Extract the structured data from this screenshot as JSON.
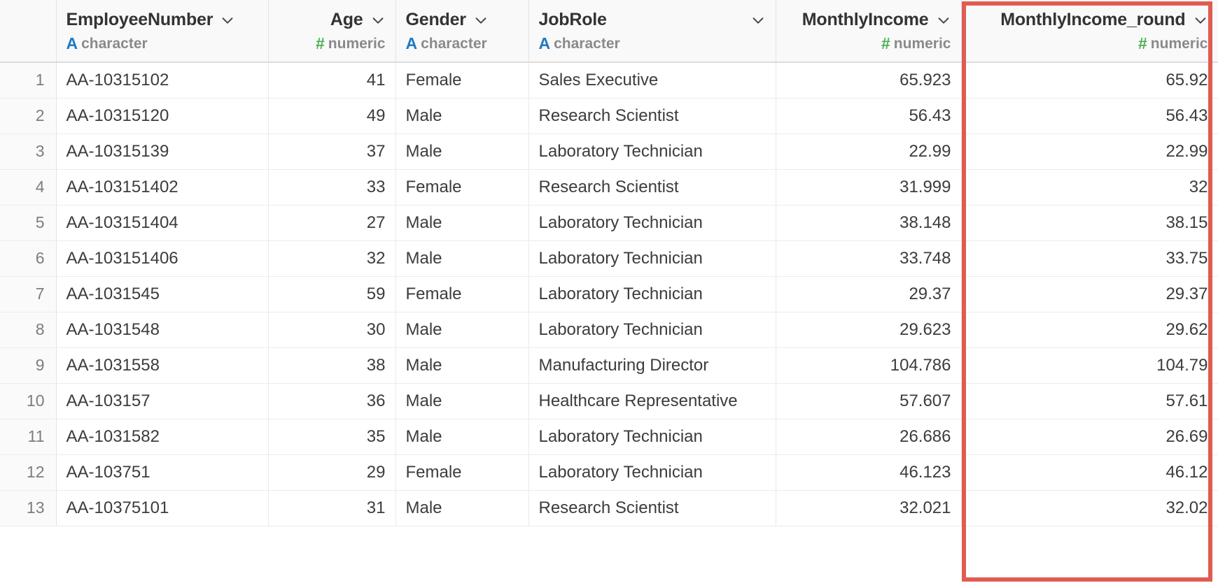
{
  "table": {
    "row_number_header": "",
    "columns": [
      {
        "name": "EmployeeNumber",
        "type_glyph": "A",
        "type_label": "character",
        "type_class": "character",
        "align": "left",
        "header_align": "align-left",
        "cell_align": "txt"
      },
      {
        "name": "Age",
        "type_glyph": "#",
        "type_label": "numeric",
        "type_class": "numeric",
        "align": "right",
        "header_align": "align-right",
        "cell_align": "num"
      },
      {
        "name": "Gender",
        "type_glyph": "A",
        "type_label": "character",
        "type_class": "character",
        "align": "left",
        "header_align": "align-left",
        "cell_align": "txt"
      },
      {
        "name": "JobRole",
        "type_glyph": "A",
        "type_label": "character",
        "type_class": "character",
        "align": "left",
        "header_align": "align-spread",
        "cell_align": "txt"
      },
      {
        "name": "MonthlyIncome",
        "type_glyph": "#",
        "type_label": "numeric",
        "type_class": "numeric",
        "align": "right",
        "header_align": "align-right",
        "cell_align": "num"
      },
      {
        "name": "MonthlyIncome_round",
        "type_glyph": "#",
        "type_label": "numeric",
        "type_class": "numeric",
        "align": "right",
        "header_align": "align-right",
        "cell_align": "num"
      }
    ],
    "rows": [
      {
        "n": "1",
        "EmployeeNumber": "AA-10315102",
        "Age": "41",
        "Gender": "Female",
        "JobRole": "Sales Executive",
        "MonthlyIncome": "65.923",
        "MonthlyIncome_round": "65.92"
      },
      {
        "n": "2",
        "EmployeeNumber": "AA-10315120",
        "Age": "49",
        "Gender": "Male",
        "JobRole": "Research Scientist",
        "MonthlyIncome": "56.43",
        "MonthlyIncome_round": "56.43"
      },
      {
        "n": "3",
        "EmployeeNumber": "AA-10315139",
        "Age": "37",
        "Gender": "Male",
        "JobRole": "Laboratory Technician",
        "MonthlyIncome": "22.99",
        "MonthlyIncome_round": "22.99"
      },
      {
        "n": "4",
        "EmployeeNumber": "AA-103151402",
        "Age": "33",
        "Gender": "Female",
        "JobRole": "Research Scientist",
        "MonthlyIncome": "31.999",
        "MonthlyIncome_round": "32"
      },
      {
        "n": "5",
        "EmployeeNumber": "AA-103151404",
        "Age": "27",
        "Gender": "Male",
        "JobRole": "Laboratory Technician",
        "MonthlyIncome": "38.148",
        "MonthlyIncome_round": "38.15"
      },
      {
        "n": "6",
        "EmployeeNumber": "AA-103151406",
        "Age": "32",
        "Gender": "Male",
        "JobRole": "Laboratory Technician",
        "MonthlyIncome": "33.748",
        "MonthlyIncome_round": "33.75"
      },
      {
        "n": "7",
        "EmployeeNumber": "AA-1031545",
        "Age": "59",
        "Gender": "Female",
        "JobRole": "Laboratory Technician",
        "MonthlyIncome": "29.37",
        "MonthlyIncome_round": "29.37"
      },
      {
        "n": "8",
        "EmployeeNumber": "AA-1031548",
        "Age": "30",
        "Gender": "Male",
        "JobRole": "Laboratory Technician",
        "MonthlyIncome": "29.623",
        "MonthlyIncome_round": "29.62"
      },
      {
        "n": "9",
        "EmployeeNumber": "AA-1031558",
        "Age": "38",
        "Gender": "Male",
        "JobRole": "Manufacturing Director",
        "MonthlyIncome": "104.786",
        "MonthlyIncome_round": "104.79"
      },
      {
        "n": "10",
        "EmployeeNumber": "AA-103157",
        "Age": "36",
        "Gender": "Male",
        "JobRole": "Healthcare Representative",
        "MonthlyIncome": "57.607",
        "MonthlyIncome_round": "57.61"
      },
      {
        "n": "11",
        "EmployeeNumber": "AA-1031582",
        "Age": "35",
        "Gender": "Male",
        "JobRole": "Laboratory Technician",
        "MonthlyIncome": "26.686",
        "MonthlyIncome_round": "26.69"
      },
      {
        "n": "12",
        "EmployeeNumber": "AA-103751",
        "Age": "29",
        "Gender": "Female",
        "JobRole": "Laboratory Technician",
        "MonthlyIncome": "46.123",
        "MonthlyIncome_round": "46.12"
      },
      {
        "n": "13",
        "EmployeeNumber": "AA-10375101",
        "Age": "31",
        "Gender": "Male",
        "JobRole": "Research Scientist",
        "MonthlyIncome": "32.021",
        "MonthlyIncome_round": "32.02"
      }
    ]
  },
  "annotation": {
    "highlighted_column": "MonthlyIncome_round",
    "highlight_color": "#e05c50"
  },
  "colors": {
    "character_type": "#1f7ac6",
    "numeric_type": "#4caf50",
    "header_bg": "#f9f9f9",
    "rownum_bg": "#fafafa",
    "text": "#3c3c3c",
    "muted_text": "#8a8a8a"
  }
}
